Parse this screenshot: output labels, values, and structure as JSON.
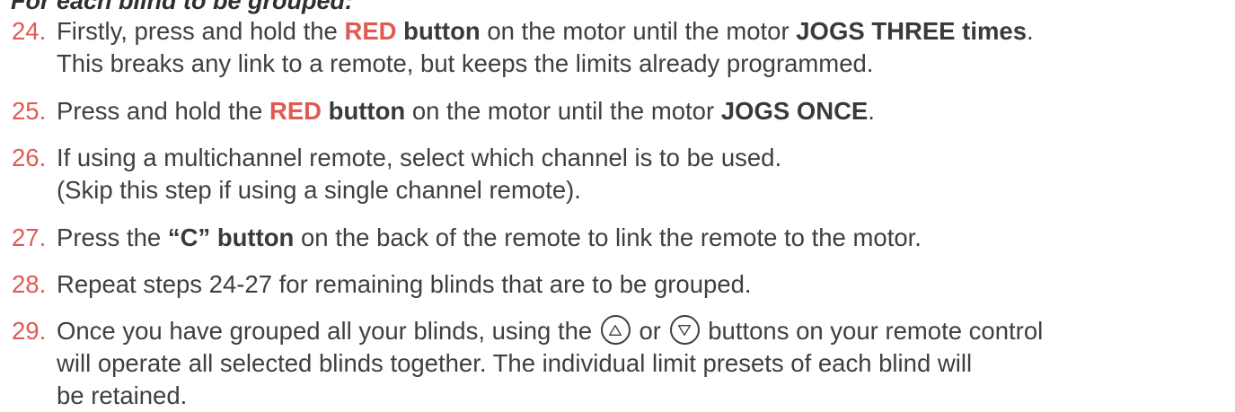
{
  "heading": "For each blind to be grouped:",
  "steps": [
    {
      "number": "24.",
      "line1": {
        "t1": "Firstly, press and hold the ",
        "red": "RED",
        "t2": " ",
        "b1": "button",
        "t3": " on the motor until the motor ",
        "b2": "JOGS THREE times",
        "t4": "."
      },
      "line2": "This breaks any link to a remote, but keeps the limits already programmed."
    },
    {
      "number": "25.",
      "line1": {
        "t1": "Press and hold the ",
        "red": "RED",
        "t2": " ",
        "b1": "button",
        "t3": " on the motor until the motor ",
        "b2": "JOGS ONCE",
        "t4": "."
      }
    },
    {
      "number": "26.",
      "line1": "If using a multichannel remote, select which channel is to be used.",
      "line2": "(Skip this step if using a single channel remote)."
    },
    {
      "number": "27.",
      "line1": {
        "t1": "Press the ",
        "b1": "“C” button",
        "t2": " on the back of the remote to link the remote to the motor."
      }
    },
    {
      "number": "28.",
      "line1": "Repeat steps 24-27 for remaining blinds that are to be grouped."
    },
    {
      "number": "29.",
      "line1": {
        "t1": "Once you have grouped all your blinds, using the ",
        "or": " or ",
        "t2": " buttons on your remote control"
      },
      "line2": "will operate all selected blinds together. The individual limit presets of each blind will",
      "line3": "be retained."
    }
  ],
  "icons": {
    "up": "up-triangle-button-icon",
    "down": "down-triangle-button-icon"
  },
  "colors": {
    "accent": "#e05a53",
    "text": "#3f3f3f"
  }
}
